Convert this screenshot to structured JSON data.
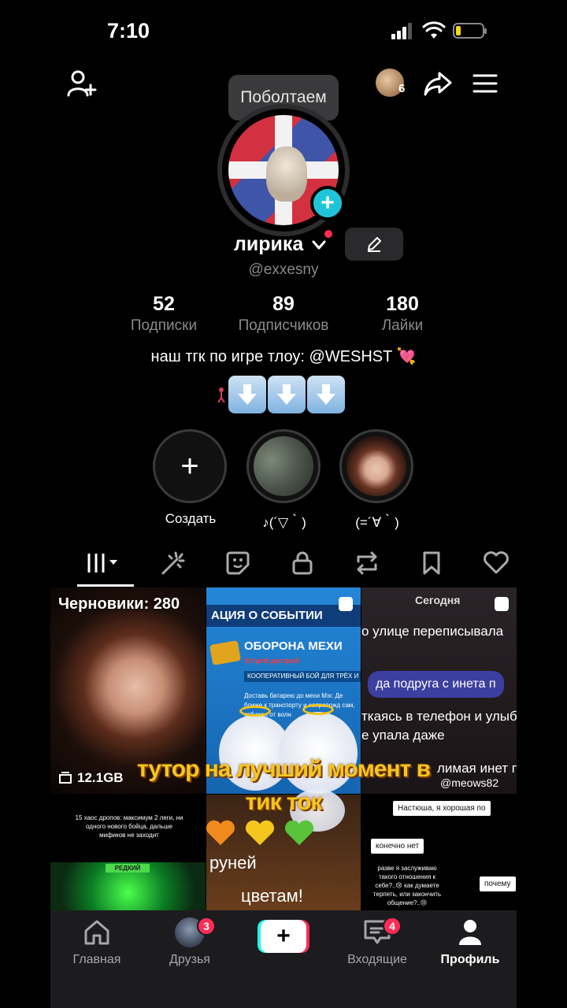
{
  "status_bar": {
    "time": "7:10"
  },
  "header": {
    "tooltip": "Поболтаем",
    "visitor_count": "6"
  },
  "profile": {
    "name": "лирика",
    "username": "@exxesny",
    "stats": [
      {
        "value": "52",
        "label": "Подписки"
      },
      {
        "value": "89",
        "label": "Подписчиков"
      },
      {
        "value": "180",
        "label": "Лайки"
      }
    ],
    "bio": "наш тгк по игре тлоу: @WESHST 💘"
  },
  "highlights": [
    {
      "label": "Создать"
    },
    {
      "label": "♪(´▽｀)"
    },
    {
      "label": "(=´∀｀)"
    }
  ],
  "tabs": [
    "videos",
    "reposts-sparkle",
    "stickers",
    "private",
    "repost",
    "saved",
    "liked"
  ],
  "grid": {
    "drafts_label": "Черновики: 280",
    "drafts_size": "12.1GB",
    "event": {
      "title": "АЦИЯ О СОБЫТИИ",
      "subtitle": "ОБОРОНА МЕХИ",
      "subtitle2": "Устрой дестрой",
      "subtitle3": "КООПЕРАТИВНЫЙ БОЙ ДЛЯ ТРЁХ И",
      "body": "Доставь батарею до мехи Мэг. Де ближе к транспорту и сопровожд сам, отбивая от волн"
    },
    "chat": {
      "date": "Сегодня",
      "line1": "о улице переписывала",
      "bubble": "да подруга с инета п",
      "line2": "ткаясь в телефон и улыб",
      "line3": "е упала даже",
      "line4": "лимая инет по",
      "watermark": "@meows82"
    },
    "caption": "тутор на лучший момент в тик ток",
    "tile4_text": "15 хаос дропов: максимум 2 леги, ни одного нового бойца, дальше мификов не заходит",
    "tile4_badge": "РЕДКИЙ",
    "tile5_text": "руней",
    "tile5_text2": "цветам!",
    "tile6": {
      "note1": "Настюша, я хорошая по",
      "note2": "конечно нет",
      "note3": "разве я заслуживаю такого отношения к себе?..😢 как думаете терпеть, или закончить общение?..😢",
      "note4": "почему"
    }
  },
  "bottom_nav": {
    "home": "Главная",
    "friends": "Друзья",
    "friends_badge": "3",
    "inbox": "Входящие",
    "inbox_badge": "4",
    "profile": "Профиль"
  }
}
